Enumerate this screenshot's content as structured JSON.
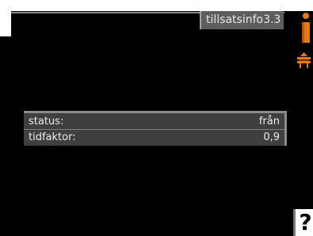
{
  "header": {
    "title": "tillsatsinfo3.3"
  },
  "info": {
    "rows": [
      {
        "label": "status:",
        "value": "från"
      },
      {
        "label": "tidfaktor:",
        "value": "0,9"
      }
    ]
  },
  "icons": {
    "info": "info-icon",
    "heating": "radiator-icon",
    "help": "?"
  },
  "colors": {
    "accent": "#e4781c",
    "accent_dark": "#c05210",
    "panel": "#3f3f3f",
    "title_tab": "#5e5e5e"
  }
}
